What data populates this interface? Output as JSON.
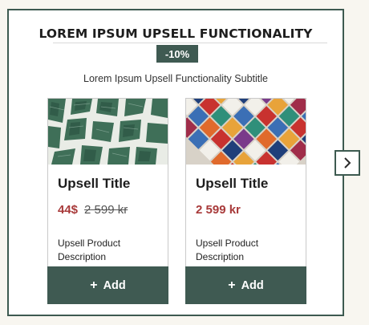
{
  "header": {
    "title": "LOREM IPSUM UPSELL FUNCTIONALITY",
    "discount_badge": "-10%",
    "subtitle": "Lorem Ipsum Upsell Functionality Subtitle"
  },
  "products": [
    {
      "image": "green-marble-tiles-image",
      "title": "Upsell Title",
      "sale_price": "44$",
      "original_price": "2 599 kr",
      "description": "Upsell Product Description",
      "button_icon": "plus-icon",
      "button_label": "Add"
    },
    {
      "image": "colorful-mosaic-tiles-image",
      "title": "Upsell Title",
      "sale_price": "2 599 kr",
      "description": "Upsell Product Description",
      "button_icon": "plus-icon",
      "button_label": "Add"
    }
  ],
  "navigation": {
    "next_icon": "chevron-right-icon"
  },
  "colors": {
    "accent": "#3f5a52",
    "sale_price": "#a83a3a",
    "background": "#f8f6f0"
  }
}
